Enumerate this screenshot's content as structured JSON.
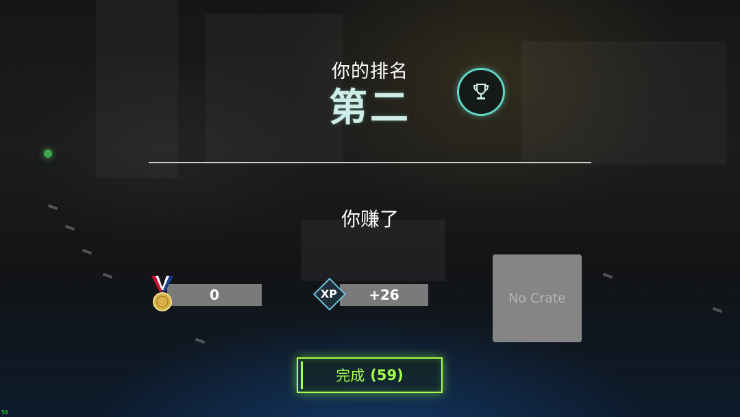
{
  "header": {
    "title_label": "你的排名",
    "rank_value": "第二",
    "trophy_icon": "trophy-icon"
  },
  "rewards": {
    "earned_label": "你赚了",
    "medal": {
      "icon": "medal-icon",
      "value": "0"
    },
    "xp": {
      "icon_label": "XP",
      "value": "+26"
    },
    "crate": {
      "label": "No Crate"
    }
  },
  "actions": {
    "done_label": "完成",
    "done_countdown": "(59)"
  },
  "debug": {
    "fps": "50"
  },
  "colors": {
    "accent_teal": "#5fd9c6",
    "button_green": "#a6ff4a",
    "bar_gray": "#7a7a7a"
  }
}
